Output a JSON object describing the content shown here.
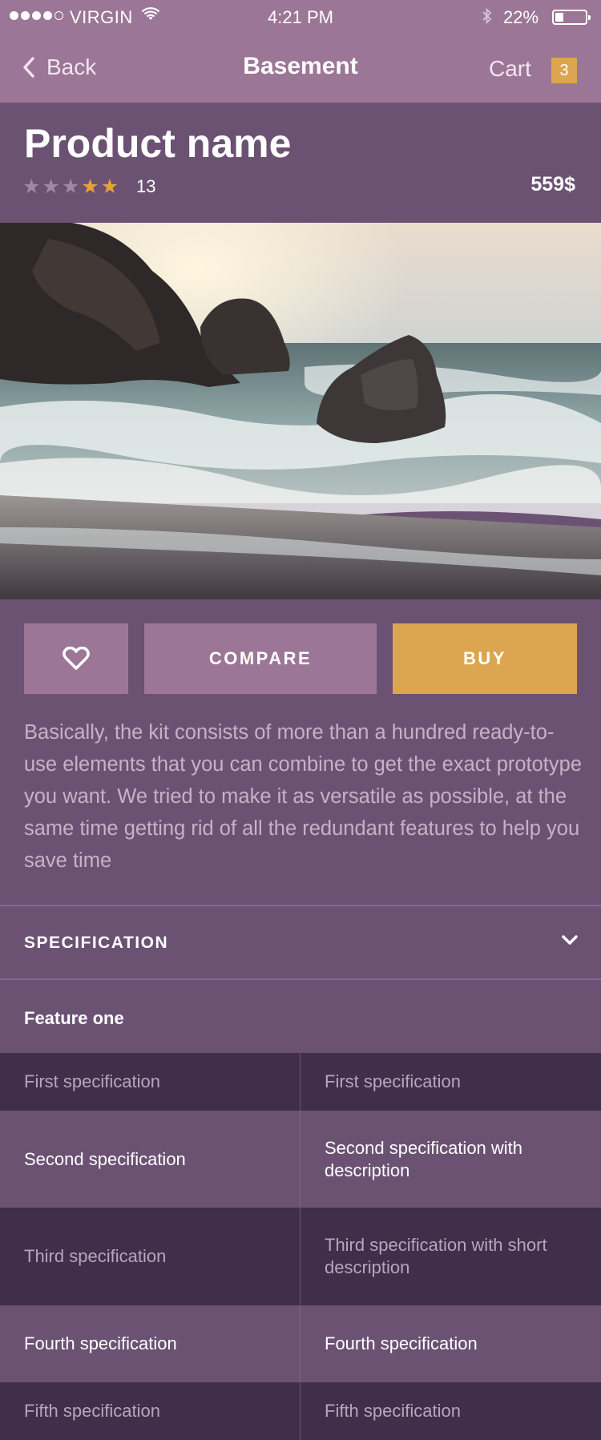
{
  "status_bar": {
    "carrier": "VIRGIN",
    "time": "4:21 PM",
    "battery": "22%"
  },
  "nav": {
    "back_label": "Back",
    "title": "Basement",
    "cart_label": "Cart",
    "cart_count": "3"
  },
  "product": {
    "name": "Product name",
    "rating": 2,
    "rating_max": 5,
    "review_count": "13",
    "price": "559$"
  },
  "actions": {
    "compare_label": "COMPARE",
    "buy_label": "BUY"
  },
  "description": "Basically, the kit consists of more than a hundred ready-to-use elements that you can combine to get the exact prototype you want. We tried to make it as versatile as possible, at the same time getting rid of all the redundant features to help you save time",
  "specification": {
    "header": "SPECIFICATION",
    "feature_title": "Feature one",
    "rows": [
      {
        "name": "First specification",
        "value": "First specification"
      },
      {
        "name": "Second specification",
        "value": "Second specification with description"
      },
      {
        "name": "Third specification",
        "value": "Third specification with short description"
      },
      {
        "name": "Fourth specification",
        "value": "Fourth specification"
      },
      {
        "name": "Fifth specification",
        "value": "Fifth specification"
      }
    ]
  },
  "colors": {
    "nav_bg": "#9c7696",
    "page_bg": "#6b5273",
    "dark_row_bg": "#3f2f4a",
    "accent": "#dca54f"
  }
}
